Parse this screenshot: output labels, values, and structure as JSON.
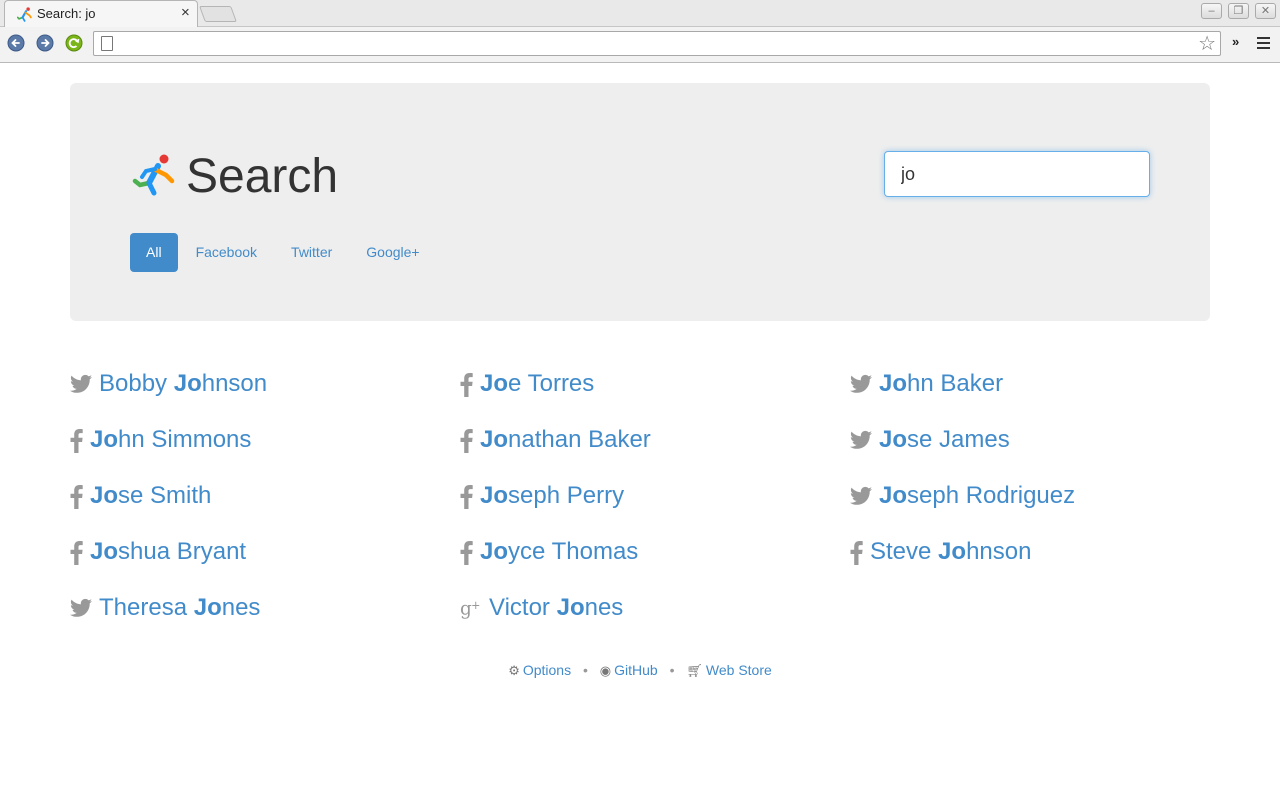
{
  "browser": {
    "tab_title": "Search: jo",
    "tab_close": "×",
    "address": "",
    "chevron": "»"
  },
  "header": {
    "title": "Search",
    "search_value": "jo"
  },
  "filters": [
    {
      "label": "All",
      "active": true
    },
    {
      "label": "Facebook",
      "active": false
    },
    {
      "label": "Twitter",
      "active": false
    },
    {
      "label": "Google+",
      "active": false
    }
  ],
  "results": [
    {
      "network": "twitter",
      "before": "Bobby ",
      "match": "Jo",
      "after": "hnson"
    },
    {
      "network": "facebook",
      "before": "",
      "match": "Jo",
      "after": "e Torres"
    },
    {
      "network": "twitter",
      "before": "",
      "match": "Jo",
      "after": "hn Baker"
    },
    {
      "network": "facebook",
      "before": "",
      "match": "Jo",
      "after": "hn Simmons"
    },
    {
      "network": "facebook",
      "before": "",
      "match": "Jo",
      "after": "nathan Baker"
    },
    {
      "network": "twitter",
      "before": "",
      "match": "Jo",
      "after": "se James"
    },
    {
      "network": "facebook",
      "before": "",
      "match": "Jo",
      "after": "se Smith"
    },
    {
      "network": "facebook",
      "before": "",
      "match": "Jo",
      "after": "seph Perry"
    },
    {
      "network": "twitter",
      "before": "",
      "match": "Jo",
      "after": "seph Rodriguez"
    },
    {
      "network": "facebook",
      "before": "",
      "match": "Jo",
      "after": "shua Bryant"
    },
    {
      "network": "facebook",
      "before": "",
      "match": "Jo",
      "after": "yce Thomas"
    },
    {
      "network": "facebook",
      "before": "Steve ",
      "match": "Jo",
      "after": "hnson"
    },
    {
      "network": "twitter",
      "before": "Theresa ",
      "match": "Jo",
      "after": "nes"
    },
    {
      "network": "googleplus",
      "before": "Victor ",
      "match": "Jo",
      "after": "nes"
    }
  ],
  "footer": {
    "options": "Options",
    "github": "GitHub",
    "webstore": "Web Store",
    "separator": "•"
  },
  "colors": {
    "accent": "#428bca",
    "icon_gray": "#999999",
    "jumbotron": "#eeeeee"
  }
}
